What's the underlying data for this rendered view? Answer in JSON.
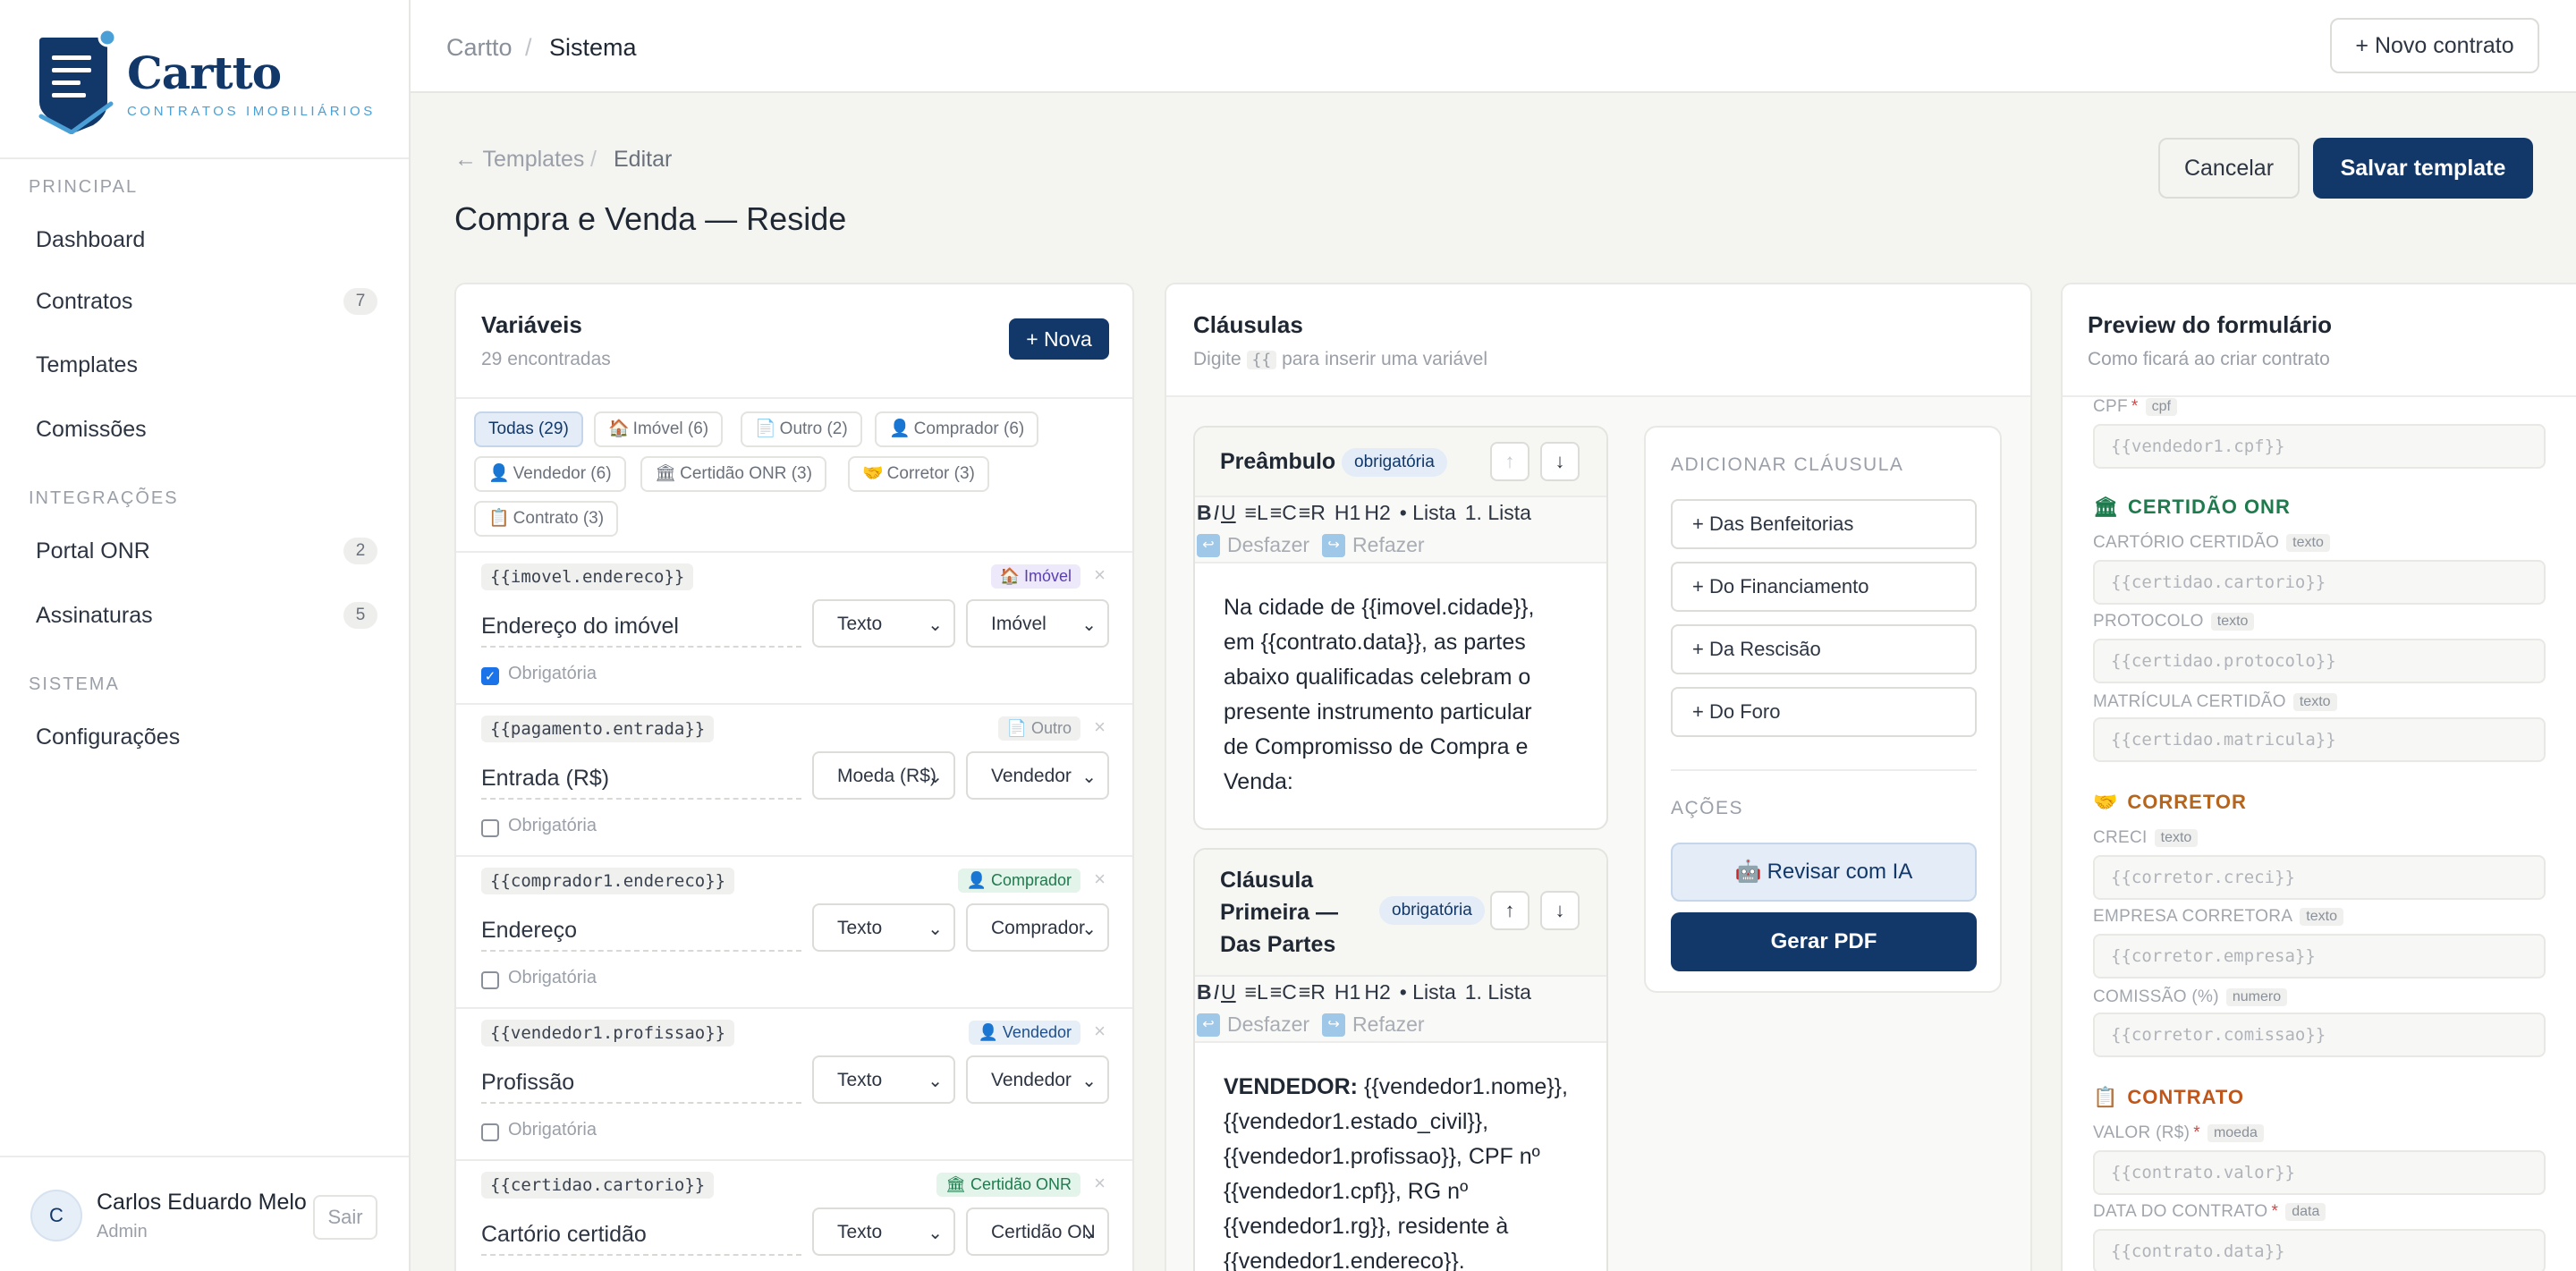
{
  "app": {
    "name": "Cartto",
    "tagline": "CONTRATOS IMOBILIÁRIOS"
  },
  "sidebar": {
    "sections": [
      {
        "title": "PRINCIPAL",
        "items": [
          {
            "label": "Dashboard",
            "badge": ""
          },
          {
            "label": "Contratos",
            "badge": "7"
          },
          {
            "label": "Templates",
            "badge": ""
          },
          {
            "label": "Comissões",
            "badge": ""
          }
        ]
      },
      {
        "title": "INTEGRAÇÕES",
        "items": [
          {
            "label": "Portal ONR",
            "badge": "2"
          },
          {
            "label": "Assinaturas",
            "badge": "5"
          }
        ]
      },
      {
        "title": "SISTEMA",
        "items": [
          {
            "label": "Configurações",
            "badge": ""
          }
        ]
      }
    ],
    "user": {
      "initial": "C",
      "name": "Carlos Eduardo Melo",
      "role": "Admin",
      "logout": "Sair"
    }
  },
  "topbar": {
    "breadcrumb_root": "Cartto",
    "breadcrumb_sep": "/",
    "breadcrumb_current": "Sistema",
    "new_contract": "+ Novo contrato"
  },
  "page": {
    "back_link": "← Templates",
    "sep": "/",
    "subcrumb": "Editar",
    "title": "Compra e Venda — Reside",
    "cancel": "Cancelar",
    "save": "Salvar template"
  },
  "variables": {
    "title": "Variáveis",
    "count": "29 encontradas",
    "new_button": "+ Nova",
    "filters": [
      {
        "label": "Todas (29)",
        "icon": ""
      },
      {
        "label": "Imóvel (6)",
        "icon": "🏠"
      },
      {
        "label": "Outro (2)",
        "icon": "📄"
      },
      {
        "label": "Comprador (6)",
        "icon": "👤"
      },
      {
        "label": "Vendedor (6)",
        "icon": "👤"
      },
      {
        "label": "Certidão ONR (3)",
        "icon": "🏛"
      },
      {
        "label": "Corretor (3)",
        "icon": "🤝"
      },
      {
        "label": "Contrato (3)",
        "icon": "📋"
      }
    ],
    "items": [
      {
        "key": "{{imovel.endereco}}",
        "tag": "Imóvel",
        "tag_icon": "🏠",
        "label": "Endereço do imóvel",
        "type": "Texto",
        "group": "Imóvel",
        "required_label": "Obrigatória",
        "required": true
      },
      {
        "key": "{{pagamento.entrada}}",
        "tag": "Outro",
        "tag_icon": "📄",
        "label": "Entrada (R$)",
        "type": "Moeda (R$)",
        "group": "Vendedor",
        "required_label": "Obrigatória",
        "required": false
      },
      {
        "key": "{{comprador1.endereco}}",
        "tag": "Comprador",
        "tag_icon": "👤",
        "label": "Endereço",
        "type": "Texto",
        "group": "Comprador",
        "required_label": "Obrigatória",
        "required": false
      },
      {
        "key": "{{vendedor1.profissao}}",
        "tag": "Vendedor",
        "tag_icon": "👤",
        "label": "Profissão",
        "type": "Texto",
        "group": "Vendedor",
        "required_label": "Obrigatória",
        "required": false
      },
      {
        "key": "{{certidao.cartorio}}",
        "tag": "Certidão ONR",
        "tag_icon": "🏛",
        "label": "Cartório certidão",
        "type": "Texto",
        "group": "Certidão ON",
        "required_label": "Obrigatória",
        "required": false
      }
    ]
  },
  "clauses": {
    "title": "Cláusulas",
    "sub_prefix": "Digite",
    "sub_token": "{{",
    "sub_suffix": "para inserir uma variável",
    "toolbar": {
      "bold": "B",
      "italic": "I",
      "underline": "U",
      "left": "≡L",
      "center": "≡C",
      "right": "≡R",
      "h1": "H1",
      "h2": "H2",
      "bullet": "• Lista",
      "ordered": "1. Lista",
      "undo": "Desfazer",
      "redo": "Refazer"
    },
    "items": [
      {
        "title": "Preâmbulo",
        "badge": "obrigatória",
        "text_lines": [
          "Na cidade de {{imovel.cidade}},",
          "em {{contrato.data}}, as partes",
          "abaixo qualificadas celebram o",
          "presente instrumento particular",
          "de Compromisso de Compra e",
          "Venda:"
        ]
      },
      {
        "title_lines": [
          "Cláusula",
          "Primeira —",
          "Das Partes"
        ],
        "badge": "obrigatória",
        "lead": "VENDEDOR:",
        "text_first": "{{vendedor1.nome}},",
        "text_lines": [
          "{{vendedor1.estado_civil}},",
          "{{vendedor1.profissao}}, CPF nº",
          "{{vendedor1.cpf}}, RG nº",
          "{{vendedor1.rg}}, residente à",
          "{{vendedor1.endereco}}."
        ]
      }
    ],
    "add_title": "ADICIONAR CLÁUSULA",
    "add_buttons": [
      "+ Das Benfeitorias",
      "+ Do Financiamento",
      "+ Da Rescisão",
      "+ Do Foro"
    ],
    "actions_title": "AÇÕES",
    "review_ai": "Revisar com IA",
    "generate_pdf": "Gerar PDF"
  },
  "preview": {
    "title": "Preview do formulário",
    "sub": "Como ficará ao criar contrato",
    "top_field": {
      "label": "CPF",
      "required": "*",
      "type": "cpf",
      "placeholder": "{{vendedor1.cpf}}"
    },
    "sections": [
      {
        "title": "CERTIDÃO ONR",
        "icon": "🏛",
        "color": "#1f7a4d",
        "fields": [
          {
            "label": "CARTÓRIO CERTIDÃO",
            "required": "",
            "type": "texto",
            "placeholder": "{{certidao.cartorio}}"
          },
          {
            "label": "PROTOCOLO",
            "required": "",
            "type": "texto",
            "placeholder": "{{certidao.protocolo}}"
          },
          {
            "label": "MATRÍCULA CERTIDÃO",
            "required": "",
            "type": "texto",
            "placeholder": "{{certidao.matricula}}"
          }
        ]
      },
      {
        "title": "CORRETOR",
        "icon": "🤝",
        "color": "#b5651d",
        "fields": [
          {
            "label": "CRECI",
            "required": "",
            "type": "texto",
            "placeholder": "{{corretor.creci}}"
          },
          {
            "label": "EMPRESA CORRETORA",
            "required": "",
            "type": "texto",
            "placeholder": "{{corretor.empresa}}"
          },
          {
            "label": "COMISSÃO (%)",
            "required": "",
            "type": "numero",
            "placeholder": "{{corretor.comissao}}"
          }
        ]
      },
      {
        "title": "CONTRATO",
        "icon": "📋",
        "color": "#c0561a",
        "fields": [
          {
            "label": "VALOR (R$)",
            "required": "*",
            "type": "moeda",
            "placeholder": "{{contrato.valor}}"
          },
          {
            "label": "DATA DO CONTRATO",
            "required": "*",
            "type": "data",
            "placeholder": "{{contrato.data}}"
          }
        ]
      }
    ]
  },
  "colors": {
    "brand": "#12386a",
    "accent": "#4aa0d6",
    "background": "#f4f4f1"
  }
}
